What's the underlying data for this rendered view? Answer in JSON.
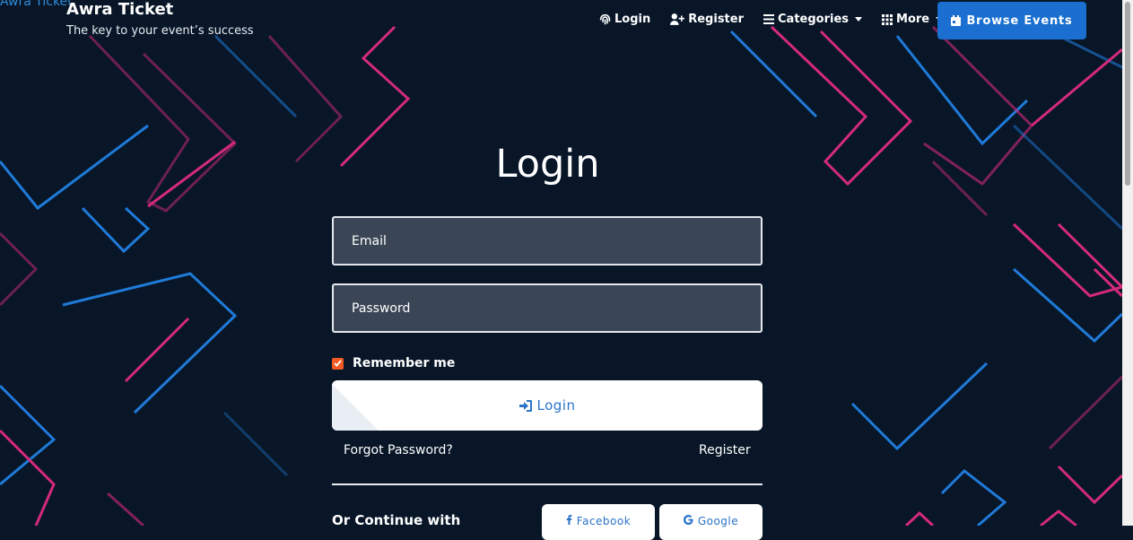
{
  "brand": {
    "logo_alt": "Awra Ticket",
    "title": "Awra Ticket",
    "tagline": "The key to your event’s success"
  },
  "nav": {
    "login": "Login",
    "register": "Register",
    "categories": "Categories",
    "more": "More",
    "browse_events": "Browse Events"
  },
  "form": {
    "title": "Login",
    "email_placeholder": "Email",
    "password_placeholder": "Password",
    "remember_label": "Remember me",
    "remember_checked": true,
    "submit_label": "Login",
    "forgot_label": "Forgot Password?",
    "register_label": "Register",
    "or_continue": "Or Continue with",
    "facebook_label": "Facebook",
    "google_label": "Google"
  },
  "colors": {
    "background": "#081628",
    "accent_blue": "#1a6fd0",
    "line_pink": "#d42a7c",
    "line_blue": "#1f7ad8",
    "checkbox": "#f15a24"
  }
}
